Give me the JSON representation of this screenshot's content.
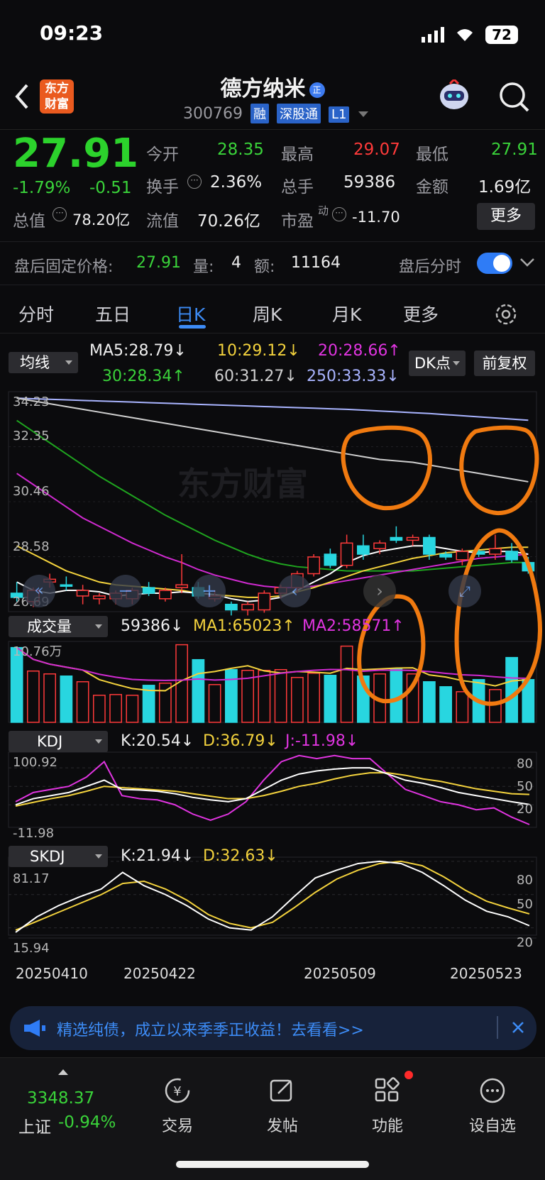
{
  "status": {
    "time": "09:23",
    "battery": "72"
  },
  "header": {
    "logo_line1": "东方",
    "logo_line2": "财富",
    "stock_name": "德方纳米",
    "stock_code": "300769",
    "tags": [
      "融",
      "深股通",
      "L1"
    ]
  },
  "quote": {
    "price": "27.91",
    "change_pct": "-1.79%",
    "change": "-0.51",
    "open_label": "今开",
    "open": "28.35",
    "high_label": "最高",
    "high": "29.07",
    "low_label": "最低",
    "low": "27.91",
    "turnover_label": "换手",
    "turnover": "2.36%",
    "volume_label": "总手",
    "volume": "59386",
    "amount_label": "金额",
    "amount": "1.69亿",
    "mktcap_label": "总值",
    "mktcap": "78.20亿",
    "float_label": "流值",
    "float": "70.26亿",
    "pe_label": "市盈",
    "pe_sup": "动",
    "pe": "-11.70",
    "more": "更多"
  },
  "after_hours": {
    "label": "盘后固定价格:",
    "price": "27.91",
    "vol_label": "量:",
    "vol": "4",
    "amt_label": "额:",
    "amt": "11164",
    "toggle_label": "盘后分时"
  },
  "tabs": [
    "分时",
    "五日",
    "日K",
    "周K",
    "月K",
    "更多"
  ],
  "ma": {
    "button": "均线",
    "ma5": "MA5:28.79↓",
    "ma10": "10:29.12↓",
    "ma20": "20:28.66↑",
    "ma30": "30:28.34↑",
    "ma60": "60:31.27↓",
    "ma250": "250:33.33↓",
    "dk": "DK点",
    "fq": "前复权"
  },
  "price_axis": [
    "34.23",
    "32.35",
    "30.46",
    "28.58",
    "26.69"
  ],
  "vol_panel": {
    "button": "成交量",
    "v": "59386↓",
    "ma1": "MA1:65023↑",
    "ma2": "MA2:58571↑",
    "top": "10.76万"
  },
  "kdj_panel": {
    "button": "KDJ",
    "k": "K:20.54↓",
    "d": "D:36.79↓",
    "j": "J:-11.98↓",
    "top": "100.92",
    "bottom": "-11.98",
    "lv": [
      "80",
      "50",
      "20"
    ]
  },
  "skdj_panel": {
    "button": "SKDJ",
    "k": "K:21.94↓",
    "d": "D:32.63↓",
    "top": "81.17",
    "bottom": "15.94",
    "lv": [
      "80",
      "50",
      "20"
    ]
  },
  "dates": [
    "20250410",
    "20250422",
    "20250509",
    "20250523"
  ],
  "banner": {
    "text": "精选纯债，成立以来季季正收益！去看看>>"
  },
  "tabbar": {
    "index_value": "3348.37",
    "index_name": "上证",
    "index_change": "-0.94%",
    "items": [
      "交易",
      "发帖",
      "功能",
      "设自选"
    ]
  },
  "colors": {
    "up": "#ff3a3a",
    "down": "#28d6e0",
    "green": "#3ad33a",
    "accent": "#3d8cf6",
    "bg": "#0b0b0d"
  },
  "chart_data": {
    "type": "candlestick",
    "candles": [
      {
        "o": 27.2,
        "h": 27.6,
        "l": 26.9,
        "c": 27.05
      },
      {
        "o": 26.9,
        "h": 27.4,
        "l": 26.7,
        "c": 27.3
      },
      {
        "o": 27.6,
        "h": 27.9,
        "l": 27.4,
        "c": 27.7
      },
      {
        "o": 27.5,
        "h": 27.8,
        "l": 27.3,
        "c": 27.45
      },
      {
        "o": 27.1,
        "h": 27.5,
        "l": 26.8,
        "c": 27.3
      },
      {
        "o": 27.0,
        "h": 27.2,
        "l": 26.8,
        "c": 27.1
      },
      {
        "o": 27.0,
        "h": 27.3,
        "l": 26.8,
        "c": 27.2
      },
      {
        "o": 27.0,
        "h": 27.4,
        "l": 26.8,
        "c": 27.3
      },
      {
        "o": 27.4,
        "h": 27.6,
        "l": 27.1,
        "c": 27.2
      },
      {
        "o": 27.0,
        "h": 27.4,
        "l": 26.9,
        "c": 27.3
      },
      {
        "o": 27.4,
        "h": 28.6,
        "l": 27.2,
        "c": 27.5
      },
      {
        "o": 27.4,
        "h": 27.6,
        "l": 27.0,
        "c": 27.1
      },
      {
        "o": 27.0,
        "h": 27.3,
        "l": 26.9,
        "c": 27.1
      },
      {
        "o": 26.8,
        "h": 26.9,
        "l": 26.4,
        "c": 26.6
      },
      {
        "o": 26.6,
        "h": 26.9,
        "l": 26.4,
        "c": 26.8
      },
      {
        "o": 26.6,
        "h": 27.3,
        "l": 26.5,
        "c": 27.2
      },
      {
        "o": 27.2,
        "h": 27.5,
        "l": 27.0,
        "c": 27.4
      },
      {
        "o": 27.4,
        "h": 28.0,
        "l": 27.2,
        "c": 27.9
      },
      {
        "o": 27.9,
        "h": 28.6,
        "l": 27.8,
        "c": 28.5
      },
      {
        "o": 28.6,
        "h": 28.8,
        "l": 28.1,
        "c": 28.2
      },
      {
        "o": 28.2,
        "h": 29.3,
        "l": 28.1,
        "c": 29.0
      },
      {
        "o": 28.9,
        "h": 29.3,
        "l": 28.4,
        "c": 28.6
      },
      {
        "o": 28.8,
        "h": 29.1,
        "l": 28.6,
        "c": 29.0
      },
      {
        "o": 29.2,
        "h": 29.6,
        "l": 29.0,
        "c": 29.1
      },
      {
        "o": 29.1,
        "h": 29.3,
        "l": 28.9,
        "c": 29.2
      },
      {
        "o": 29.2,
        "h": 29.3,
        "l": 28.4,
        "c": 28.6
      },
      {
        "o": 28.6,
        "h": 28.7,
        "l": 28.4,
        "c": 28.5
      },
      {
        "o": 28.4,
        "h": 28.8,
        "l": 28.2,
        "c": 28.7
      },
      {
        "o": 28.7,
        "h": 28.8,
        "l": 28.5,
        "c": 28.6
      },
      {
        "o": 28.6,
        "h": 29.3,
        "l": 28.4,
        "c": 28.8
      },
      {
        "o": 28.7,
        "h": 29.0,
        "l": 28.3,
        "c": 28.4
      },
      {
        "o": 28.3,
        "h": 28.5,
        "l": 27.9,
        "c": 28.0
      }
    ],
    "ylim": [
      26.69,
      34.23
    ],
    "ma5": [
      27.6,
      27.3,
      27.2,
      27.3,
      27.3,
      27.25,
      27.1,
      27.15,
      27.2,
      27.2,
      27.25,
      27.2,
      27.15,
      27.0,
      26.9,
      26.95,
      27.05,
      27.3,
      27.6,
      27.9,
      28.3,
      28.55,
      28.7,
      28.8,
      28.9,
      28.9,
      28.8,
      28.7,
      28.65,
      28.7,
      28.7,
      28.6
    ],
    "ma10": [
      28.9,
      28.6,
      28.3,
      28.0,
      27.8,
      27.6,
      27.5,
      27.45,
      27.4,
      27.35,
      27.3,
      27.2,
      27.15,
      27.1,
      27.05,
      27.05,
      27.1,
      27.25,
      27.4,
      27.6,
      27.8,
      28.0,
      28.15,
      28.3,
      28.45,
      28.55,
      28.65,
      28.7,
      28.75,
      28.8,
      28.85,
      28.85
    ],
    "ma20": [
      31.5,
      31.1,
      30.7,
      30.3,
      29.9,
      29.6,
      29.3,
      29.0,
      28.75,
      28.5,
      28.3,
      28.05,
      27.85,
      27.7,
      27.55,
      27.45,
      27.4,
      27.4,
      27.45,
      27.55,
      27.65,
      27.75,
      27.85,
      27.95,
      28.05,
      28.15,
      28.25,
      28.35,
      28.45,
      28.5,
      28.55,
      28.6
    ],
    "ma30": [
      33.4,
      33.0,
      32.6,
      32.2,
      31.8,
      31.4,
      31.05,
      30.7,
      30.35,
      30.0,
      29.7,
      29.4,
      29.1,
      28.85,
      28.6,
      28.4,
      28.25,
      28.15,
      28.1,
      28.05,
      28.0,
      28.0,
      28.0,
      28.0,
      28.0,
      28.05,
      28.1,
      28.15,
      28.2,
      28.25,
      28.3,
      28.3
    ],
    "ma60": [
      34.2,
      34.1,
      34.0,
      33.9,
      33.8,
      33.7,
      33.6,
      33.5,
      33.4,
      33.3,
      33.2,
      33.1,
      33.0,
      32.9,
      32.8,
      32.7,
      32.6,
      32.5,
      32.4,
      32.3,
      32.2,
      32.1,
      32.0,
      31.95,
      31.9,
      31.8,
      31.7,
      31.6,
      31.5,
      31.4,
      31.3,
      31.2
    ],
    "ma250": [
      34.2,
      34.18,
      34.16,
      34.14,
      34.12,
      34.1,
      34.08,
      34.06,
      34.04,
      34.02,
      34.0,
      33.98,
      33.96,
      33.94,
      33.92,
      33.9,
      33.88,
      33.86,
      33.84,
      33.82,
      33.8,
      33.77,
      33.74,
      33.71,
      33.68,
      33.65,
      33.61,
      33.57,
      33.53,
      33.49,
      33.45,
      33.41
    ],
    "volume": [
      10.5,
      7.2,
      6.8,
      6.5,
      5.7,
      3.8,
      3.9,
      3.8,
      5.2,
      5.5,
      10.9,
      8.8,
      5.3,
      7.4,
      7.3,
      7.3,
      7.4,
      6.3,
      6.9,
      6.6,
      10.7,
      6.5,
      6.8,
      7.5,
      6.8,
      5.7,
      5.0,
      4.3,
      6.0,
      4.6,
      9.1,
      6.0
    ],
    "vol_ylim": [
      0,
      10.76
    ],
    "kdj_k": [
      20,
      30,
      35,
      40,
      50,
      60,
      45,
      44,
      42,
      38,
      32,
      28,
      25,
      30,
      45,
      60,
      70,
      75,
      78,
      80,
      80,
      70,
      60,
      55,
      48,
      40,
      35,
      30,
      25,
      20.54
    ],
    "kdj_d": [
      18,
      24,
      30,
      35,
      42,
      50,
      48,
      46,
      44,
      42,
      38,
      34,
      30,
      30,
      35,
      42,
      50,
      55,
      62,
      68,
      72,
      72,
      68,
      62,
      58,
      52,
      46,
      42,
      38,
      36.79
    ],
    "kdj_j": [
      25,
      40,
      45,
      50,
      65,
      90,
      35,
      30,
      28,
      20,
      5,
      -5,
      5,
      25,
      60,
      90,
      100,
      95,
      100,
      95,
      95,
      70,
      45,
      35,
      25,
      20,
      12,
      15,
      0,
      -11.98
    ],
    "kdj_ylim": [
      -11.98,
      100.92
    ],
    "skdj_k": [
      16,
      30,
      40,
      48,
      55,
      70,
      58,
      50,
      40,
      28,
      20,
      18,
      30,
      48,
      65,
      72,
      78,
      80,
      78,
      70,
      58,
      45,
      35,
      30,
      21.94
    ],
    "skdj_d": [
      18,
      26,
      34,
      42,
      50,
      60,
      62,
      55,
      45,
      32,
      24,
      20,
      25,
      38,
      52,
      64,
      72,
      78,
      80,
      76,
      66,
      54,
      44,
      38,
      32.63
    ],
    "skdj_ylim": [
      15.94,
      81.17
    ]
  }
}
